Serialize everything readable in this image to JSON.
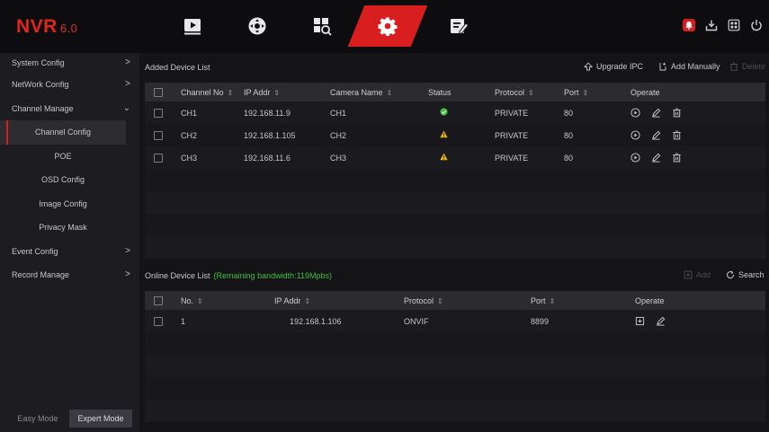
{
  "app": {
    "logo": "NVR",
    "version": "6.0"
  },
  "top_nav": [
    {
      "name": "playback-icon",
      "active": false
    },
    {
      "name": "ptz-control-icon",
      "active": false
    },
    {
      "name": "search-files-icon",
      "active": false
    },
    {
      "name": "settings-gear-icon",
      "active": true
    },
    {
      "name": "edit-task-icon",
      "active": false
    }
  ],
  "system_icons": [
    "alarm-icon",
    "backup-icon",
    "multi-screen-icon",
    "power-icon"
  ],
  "sidebar": {
    "items": [
      {
        "label": "System Config",
        "arrow": ">"
      },
      {
        "label": "NetWork Config",
        "arrow": ">"
      },
      {
        "label": "Channel Manage",
        "arrow": "v"
      },
      {
        "label": "Channel Config"
      },
      {
        "label": "POE"
      },
      {
        "label": "OSD Config"
      },
      {
        "label": "Image Config"
      },
      {
        "label": "Privacy Mask"
      },
      {
        "label": "Event Config",
        "arrow": ">"
      },
      {
        "label": "Record Manage",
        "arrow": ">"
      }
    ],
    "modes": [
      "Easy Mode",
      "Expert Mode"
    ]
  },
  "added_list": {
    "title": "Added Device List",
    "upgrade_label": "Upgrade IPC",
    "add_manually_label": "Add Manually",
    "delete_label": "Delete",
    "columns": [
      "Channel No",
      "IP Addr",
      "Camera Name",
      "Status",
      "Protocol",
      "Port",
      "Operate"
    ],
    "rows": [
      {
        "channel": "CH1",
        "ip": "192.168.11.9",
        "name": "CH1",
        "status": "online",
        "protocol": "PRIVATE",
        "port": "80"
      },
      {
        "channel": "CH2",
        "ip": "192.168.1.105",
        "name": "CH2",
        "status": "warning",
        "protocol": "PRIVATE",
        "port": "80"
      },
      {
        "channel": "CH3",
        "ip": "192.168.11.6",
        "name": "CH3",
        "status": "warning",
        "protocol": "PRIVATE",
        "port": "80"
      }
    ]
  },
  "online_list": {
    "title": "Online Device List",
    "bandwidth": "(Remaining bandwidth:119Mpbs)",
    "add_label": "Add",
    "search_label": "Search",
    "columns": [
      "No.",
      "IP Addr",
      "Protocol",
      "Port",
      "Operate"
    ],
    "rows": [
      {
        "no": "1",
        "ip": "192.168.1.106",
        "protocol": "ONVIF",
        "port": "8899"
      }
    ]
  },
  "colors": {
    "accent": "#d81e1e",
    "ok": "#3fbf3f",
    "warn": "#e8b40c"
  }
}
